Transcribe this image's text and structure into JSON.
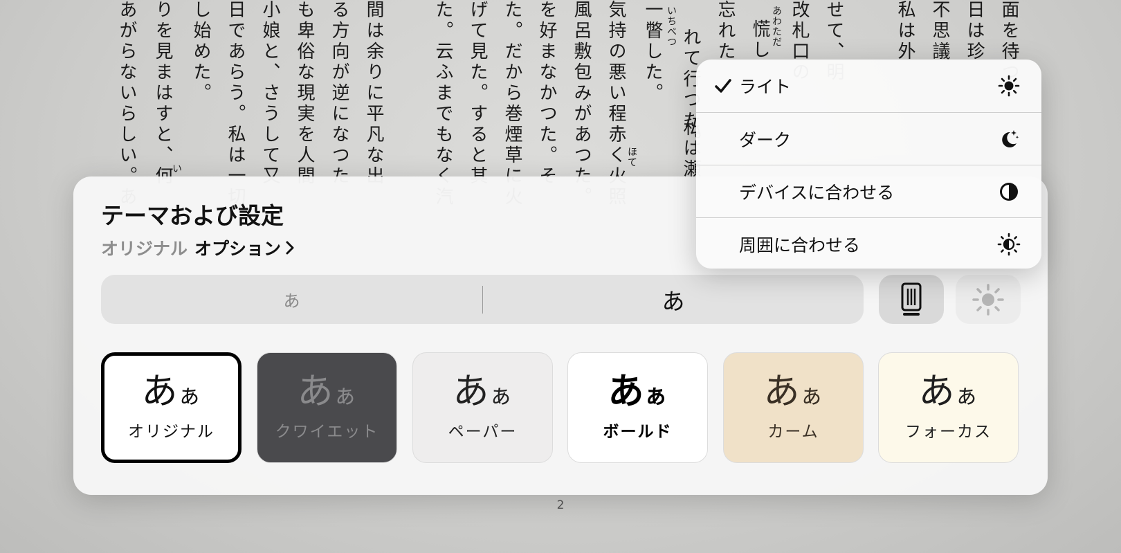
{
  "book": {
    "columns": [
      "面を待つ",
      "日は珍",
      "不思議",
      "私は外",
      "せて、明",
      "改札口の",
      "慌し",
      "忘れた",
      "れて行つた。",
      "私は瀬",
      "一瞥した。",
      "気持の悪い程赤く火照",
      "風呂敷包みがあつた。",
      "を好まなかつた。そ",
      "た。だから巻煙草に火",
      "げて見た。すると其",
      "た。云ふまでもなく汽",
      "間は余りに平凡な出",
      "る方向が逆になつた",
      "も卑俗な現実を人間",
      "小娘と、さうして又",
      "日であらう。私は一切",
      "し始めた。",
      "りを見まはすと、何",
      "あがらないらしい。あ"
    ],
    "ruby": [
      "あわただ",
      "いちべつ",
      "ほて",
      "い"
    ],
    "page_number": "2"
  },
  "panel": {
    "title": "テーマおよび設定",
    "current_theme": "オリジナル",
    "options_label": "オプション"
  },
  "font_size": {
    "small_label": "あ",
    "large_label": "あ"
  },
  "themes": [
    {
      "name": "オリジナル",
      "glyph": "あ",
      "glyph_small": "ぁ",
      "bg": "#ffffff",
      "fg": "#111111",
      "selected": true
    },
    {
      "name": "クワイエット",
      "glyph": "あ",
      "glyph_small": "ぁ",
      "bg": "#4a4a4d",
      "fg": "#8a8a8c",
      "selected": false
    },
    {
      "name": "ペーパー",
      "glyph": "あ",
      "glyph_small": "ぁ",
      "bg": "#eeeded",
      "fg": "#222222",
      "selected": false
    },
    {
      "name": "ボールド",
      "glyph": "あ",
      "glyph_small": "ぁ",
      "bg": "#ffffff",
      "fg": "#000000",
      "selected": false
    },
    {
      "name": "カーム",
      "glyph": "あ",
      "glyph_small": "ぁ",
      "bg": "#f0e1c8",
      "fg": "#3a3025",
      "selected": false
    },
    {
      "name": "フォーカス",
      "glyph": "あ",
      "glyph_small": "ぁ",
      "bg": "#fdf9ea",
      "fg": "#1f1f1f",
      "selected": false
    }
  ],
  "appearance_menu": {
    "items": [
      {
        "label": "ライト",
        "checked": true,
        "icon": "sun-icon"
      },
      {
        "label": "ダーク",
        "checked": false,
        "icon": "moon-stars-icon"
      },
      {
        "label": "デバイスに合わせる",
        "checked": false,
        "icon": "half-circle-icon"
      },
      {
        "label": "周囲に合わせる",
        "checked": false,
        "icon": "auto-brightness-icon"
      }
    ]
  },
  "colors": {
    "text": "#111111",
    "secondary_text": "#8d8d8d",
    "panel_bg": "#f6f6f6",
    "selected_border": "#000000"
  }
}
